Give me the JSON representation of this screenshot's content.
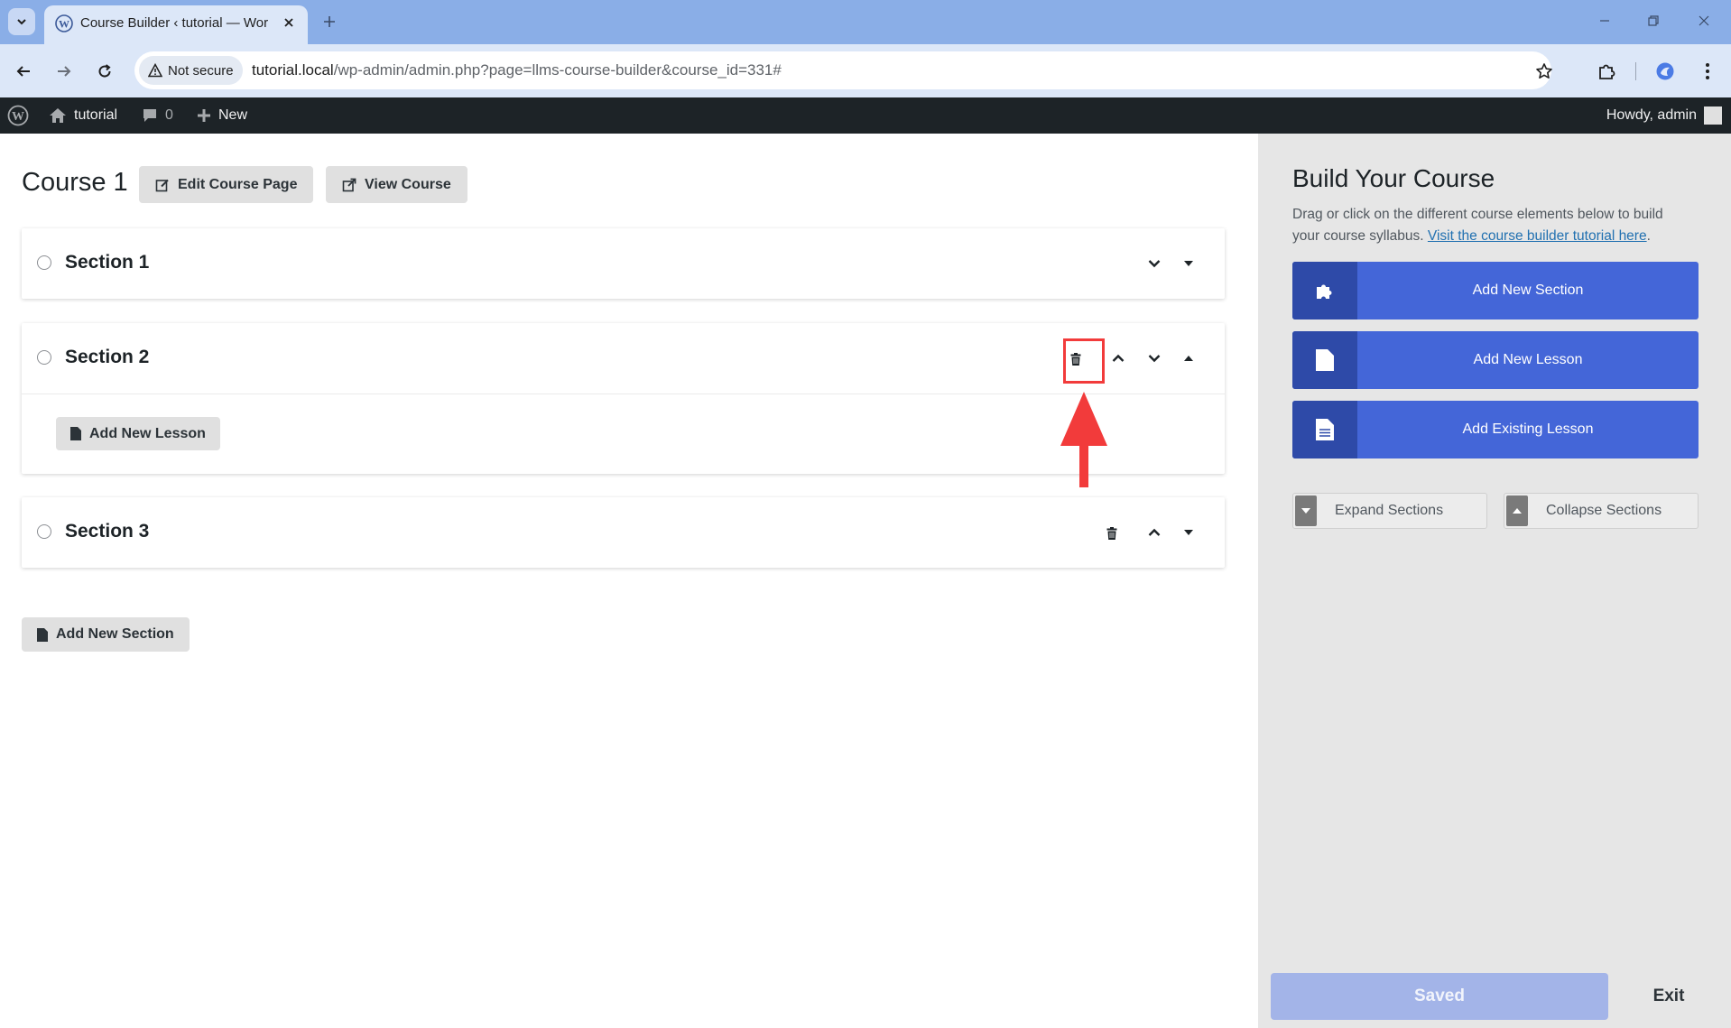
{
  "browser": {
    "tab_title": "Course Builder ‹ tutorial — Wor",
    "security_label": "Not secure",
    "url_host": "tutorial.local",
    "url_path": "/wp-admin/admin.php?page=llms-course-builder&course_id=331#"
  },
  "adminbar": {
    "site_name": "tutorial",
    "comments_count": "0",
    "new_label": "New",
    "greeting": "Howdy, admin"
  },
  "course": {
    "title": "Course 1",
    "edit_label": "Edit Course Page",
    "view_label": "View Course",
    "sections": [
      {
        "title": "Section 1"
      },
      {
        "title": "Section 2",
        "add_lesson_label": "Add New Lesson"
      },
      {
        "title": "Section 3"
      }
    ],
    "add_section_label": "Add New Section"
  },
  "sidebar": {
    "title": "Build Your Course",
    "description": "Drag or click on the different course elements below to build your course syllabus.",
    "tutorial_link": "Visit the course builder tutorial here",
    "tutorial_suffix": ".",
    "add_section": "Add New Section",
    "add_lesson": "Add New Lesson",
    "add_existing": "Add Existing Lesson",
    "expand": "Expand Sections",
    "collapse": "Collapse Sections",
    "saved": "Saved",
    "exit": "Exit"
  },
  "colors": {
    "primary_button": "#4466d8",
    "primary_icon_box": "#2e4aa8",
    "highlight": "#f23b3b",
    "adminbar": "#1d2327"
  }
}
